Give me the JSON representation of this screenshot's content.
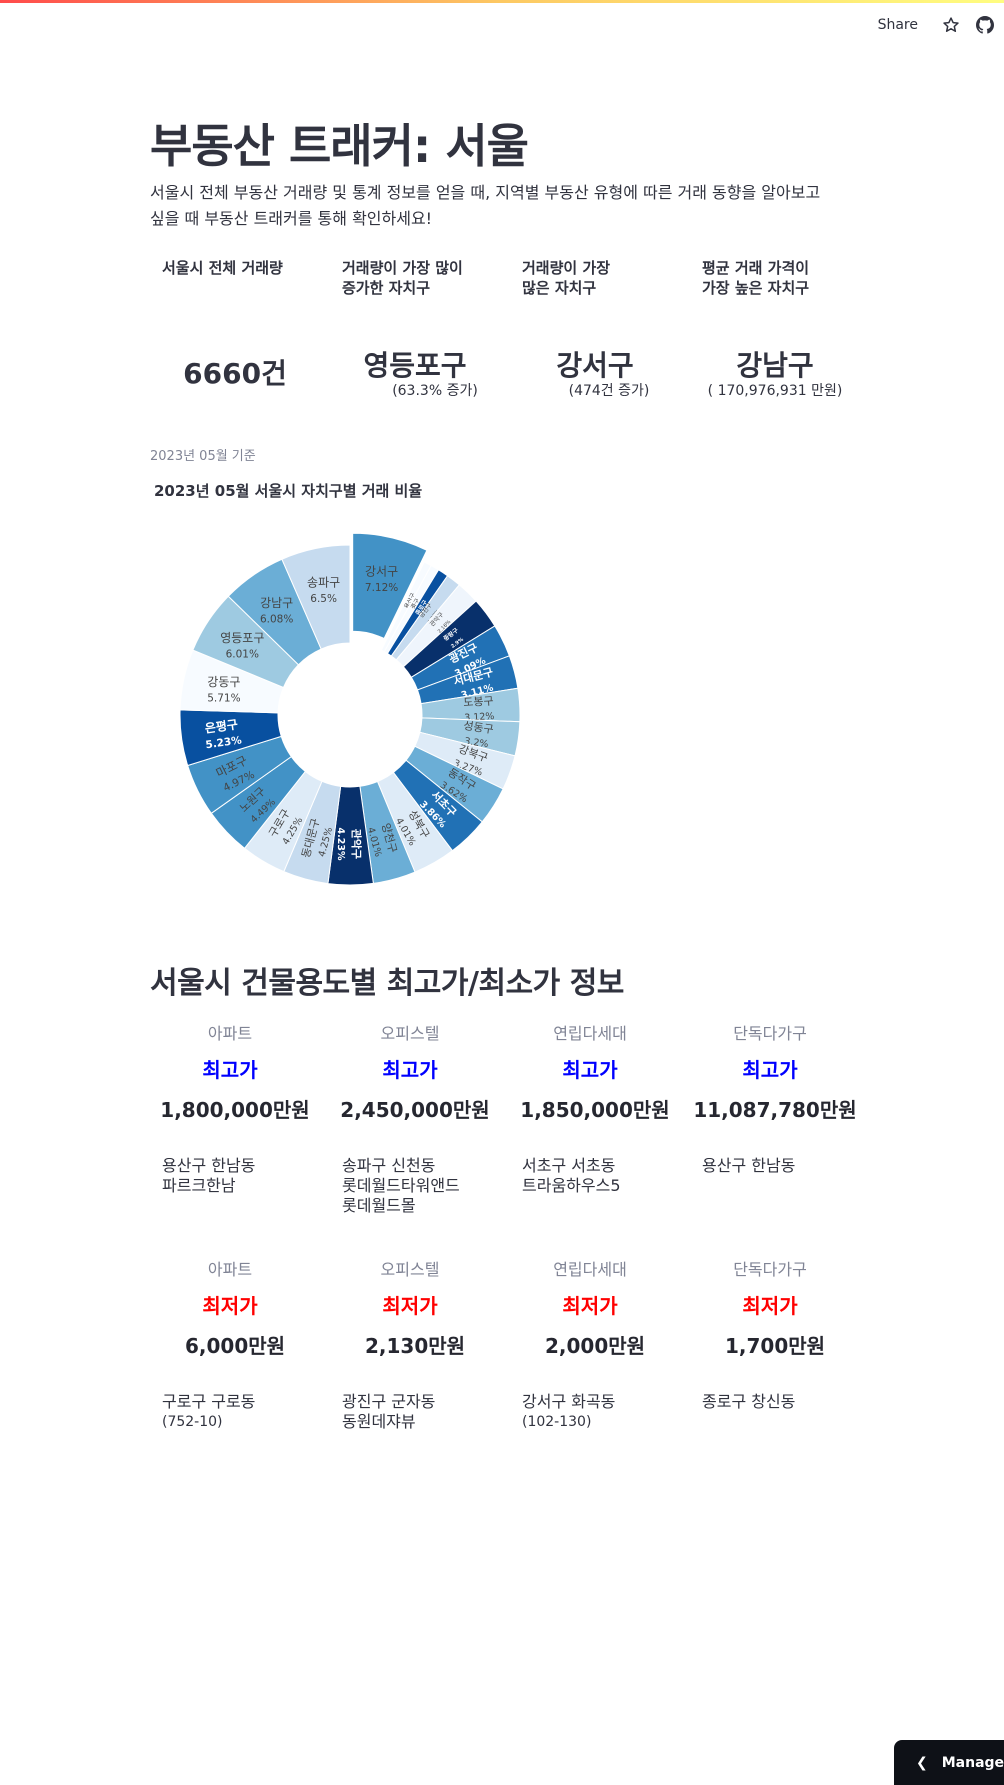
{
  "header": {
    "share": "Share"
  },
  "title": "부동산 트래커: 서울",
  "intro_lines": [
    "서울시 전체 부동산 거래량 및 통계 정보를 얻을 때, 지역별 부동산 유형에 따른 거래 동향을 알아보고",
    "싶을 때 부동산 트래커를 통해 확인하세요!"
  ],
  "metrics": [
    {
      "label_lines": [
        "서울시 전체 거래량"
      ],
      "value": "6660건",
      "delta": ""
    },
    {
      "label_lines": [
        "거래량이 가장 많이",
        "증가한 자치구"
      ],
      "value": "영등포구",
      "delta": "(63.3% 증가)"
    },
    {
      "label_lines": [
        "거래량이 가장",
        "많은 자치구"
      ],
      "value": "강서구",
      "delta": "(474건 증가)"
    },
    {
      "label_lines": [
        "평균 거래 가격이",
        "가장 높은 자치구"
      ],
      "value": "강남구",
      "delta": "( 170,976,931 만원)"
    }
  ],
  "caption": "2023년 05월 기준",
  "chart_title": "2023년 05월 서울시 자치구별 거래 비율",
  "chart_data": {
    "type": "pie",
    "title": "2023년 05월 서울시 자치구별 거래 비율",
    "hole": true,
    "pulled_slice": "강서구",
    "slices": [
      {
        "label": "강서구",
        "value": 7.12,
        "display": "7.12%",
        "color": "#4292c6",
        "dark": false
      },
      {
        "label": "용산구",
        "value": 0.72,
        "display": "",
        "color": "#f7fbff",
        "dark": false
      },
      {
        "label": "중구",
        "value": 0.8,
        "display": "",
        "color": "#f7fbff",
        "dark": false
      },
      {
        "label": "종로구",
        "value": 1.0,
        "display": "",
        "color": "#0850a0",
        "dark": true
      },
      {
        "label": "금천구",
        "value": 1.38,
        "display": "1.38%",
        "color": "#c6dbef",
        "dark": false
      },
      {
        "label": "관악구",
        "value": 2.16,
        "display": "2.16%",
        "color": "#eff5fc",
        "dark": false
      },
      {
        "label": "중랑구",
        "value": 2.9,
        "display": "2.9%",
        "color": "#08306b",
        "dark": true
      },
      {
        "label": "광진구",
        "value": 3.09,
        "display": "3.09%",
        "color": "#2171b5",
        "dark": true
      },
      {
        "label": "서대문구",
        "value": 3.11,
        "display": "3.11%",
        "color": "#2171b5",
        "dark": true
      },
      {
        "label": "도봉구",
        "value": 3.12,
        "display": "3.12%",
        "color": "#9ecae1",
        "dark": false
      },
      {
        "label": "성동구",
        "value": 3.2,
        "display": "3.2%",
        "color": "#9ecae1",
        "dark": false
      },
      {
        "label": "강북구",
        "value": 3.27,
        "display": "3.27%",
        "color": "#deebf7",
        "dark": false
      },
      {
        "label": "동작구",
        "value": 3.62,
        "display": "3.62%",
        "color": "#6baed6",
        "dark": false
      },
      {
        "label": "서초구",
        "value": 3.86,
        "display": "3.86%",
        "color": "#2171b5",
        "dark": true
      },
      {
        "label": "성북구",
        "value": 4.01,
        "display": "4.01%",
        "color": "#deebf7",
        "dark": false
      },
      {
        "label": "양천구",
        "value": 4.01,
        "display": "4.01%",
        "color": "#6baed6",
        "dark": false
      },
      {
        "label": "관악구",
        "value": 4.23,
        "display": "4.23%",
        "color": "#08306b",
        "dark": true
      },
      {
        "label": "동대문구",
        "value": 4.25,
        "display": "4.25%",
        "color": "#c6dbef",
        "dark": false
      },
      {
        "label": "구로구",
        "value": 4.25,
        "display": "4.25%",
        "color": "#deebf7",
        "dark": false
      },
      {
        "label": "노원구",
        "value": 4.49,
        "display": "4.49%",
        "color": "#4292c6",
        "dark": false
      },
      {
        "label": "마포구",
        "value": 4.97,
        "display": "4.97%",
        "color": "#4292c6",
        "dark": false
      },
      {
        "label": "은평구",
        "value": 5.23,
        "display": "5.23%",
        "color": "#0850a0",
        "dark": true
      },
      {
        "label": "강동구",
        "value": 5.71,
        "display": "5.71%",
        "color": "#f7fbff",
        "dark": false
      },
      {
        "label": "영등포구",
        "value": 6.01,
        "display": "6.01%",
        "color": "#9ecae1",
        "dark": false
      },
      {
        "label": "강남구",
        "value": 6.08,
        "display": "6.08%",
        "color": "#6baed6",
        "dark": false
      },
      {
        "label": "송파구",
        "value": 6.5,
        "display": "6.5%",
        "color": "#c6dbef",
        "dark": false
      }
    ]
  },
  "section_title": "서울시 건물용도별 최고가/최소가 정보",
  "colors": {
    "max_label": "#0000ff",
    "min_label": "#ff0000"
  },
  "max_cards": [
    {
      "type": "아파트",
      "label": "최고가",
      "price": "1,800,000만원",
      "location_lines": [
        "용산구 한남동",
        "파르크한남"
      ]
    },
    {
      "type": "오피스텔",
      "label": "최고가",
      "price": "2,450,000만원",
      "location_lines": [
        "송파구 신천동",
        "롯데월드타워앤드",
        "롯데월드몰"
      ]
    },
    {
      "type": "연립다세대",
      "label": "최고가",
      "price": "1,850,000만원",
      "location_lines": [
        "서초구 서초동",
        "트라움하우스5"
      ]
    },
    {
      "type": "단독다가구",
      "label": "최고가",
      "price": "11,087,780만원",
      "location_lines": [
        "용산구 한남동"
      ]
    }
  ],
  "min_cards": [
    {
      "type": "아파트",
      "label": "최저가",
      "price": "6,000만원",
      "location_lines": [
        "구로구 구로동",
        "(752-10)"
      ]
    },
    {
      "type": "오피스텔",
      "label": "최저가",
      "price": "2,130만원",
      "location_lines": [
        "광진구 군자동",
        "동원데쟈뷰"
      ]
    },
    {
      "type": "연립다세대",
      "label": "최저가",
      "price": "2,000만원",
      "location_lines": [
        "강서구 화곡동",
        "(102-130)"
      ]
    },
    {
      "type": "단독다가구",
      "label": "최저가",
      "price": "1,700만원",
      "location_lines": [
        "종로구 창신동"
      ]
    }
  ],
  "manage_button": "Manage app"
}
